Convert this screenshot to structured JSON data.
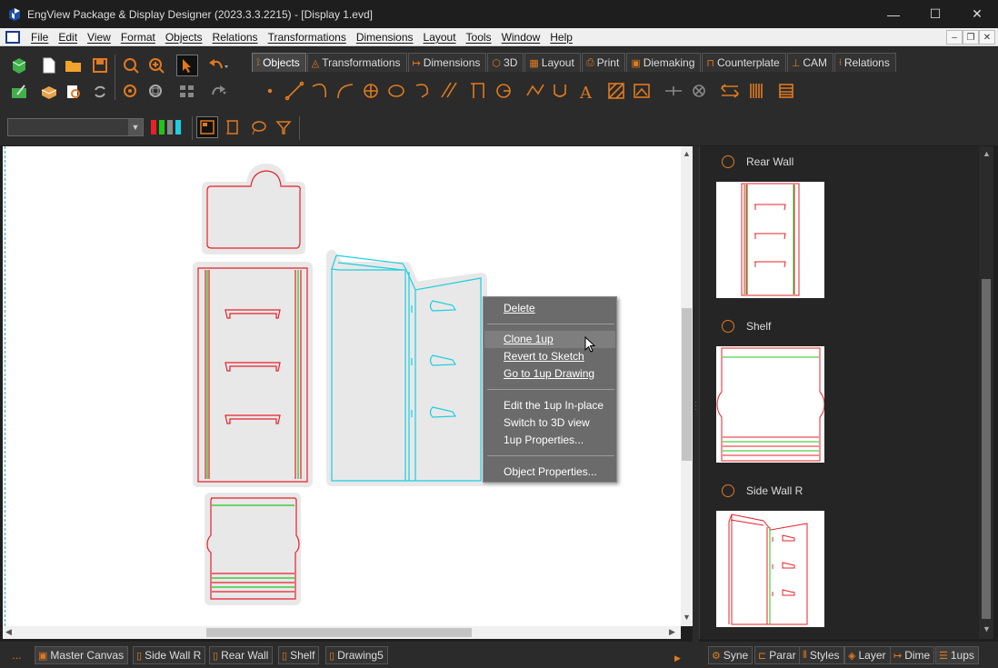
{
  "window": {
    "title": "EngView Package & Display Designer (2023.3.3.2215) - [Display 1.evd]",
    "controls": {
      "minimize": "—",
      "maximize": "☐",
      "close": "✕"
    }
  },
  "menu": [
    "File",
    "Edit",
    "View",
    "Format",
    "Objects",
    "Relations",
    "Transformations",
    "Dimensions",
    "Layout",
    "Tools",
    "Window",
    "Help"
  ],
  "mdi_controls": {
    "minimize": "–",
    "restore": "❐",
    "close": "✕"
  },
  "tabs": [
    {
      "label": "Objects",
      "icon": "objects-icon",
      "active": true
    },
    {
      "label": "Transformations",
      "icon": "transformations-icon",
      "active": false
    },
    {
      "label": "Dimensions",
      "icon": "dimensions-icon",
      "active": false
    },
    {
      "label": "3D",
      "icon": "3d-icon",
      "active": false
    },
    {
      "label": "Layout",
      "icon": "layout-icon",
      "active": false
    },
    {
      "label": "Print",
      "icon": "print-icon",
      "active": false
    },
    {
      "label": "Diemaking",
      "icon": "diemaking-icon",
      "active": false
    },
    {
      "label": "Counterplate",
      "icon": "counterplate-icon",
      "active": false
    },
    {
      "label": "CAM",
      "icon": "cam-icon",
      "active": false
    },
    {
      "label": "Relations",
      "icon": "relations-icon",
      "active": false
    }
  ],
  "combo": {
    "value": ""
  },
  "context_menu": {
    "items": [
      {
        "label": "Delete",
        "u": "D"
      },
      {
        "label": "Clone 1up",
        "u": "C",
        "hover": true
      },
      {
        "label": "Revert to Sketch",
        "u": "R"
      },
      {
        "label": "Go to 1up Drawing",
        "u": "G"
      },
      {
        "label": "Edit the 1up In-place",
        "u": ""
      },
      {
        "label": "Switch to 3D view",
        "u": ""
      },
      {
        "label": "1up Properties...",
        "u": ""
      },
      {
        "label": "Object Properties...",
        "u": "P"
      }
    ]
  },
  "ups_panel": [
    {
      "name": "Rear Wall"
    },
    {
      "name": "Shelf"
    },
    {
      "name": "Side Wall R"
    }
  ],
  "bottom_tabs": {
    "more": "...",
    "sheets": [
      "Master Canvas",
      "Side Wall R",
      "Rear Wall",
      "Shelf",
      "Drawing5"
    ],
    "panels": [
      "Syne",
      "Parar",
      "Styles",
      "Layer",
      "Dime",
      "1ups"
    ]
  },
  "colors": {
    "accent": "#e07a1f",
    "cut_line": "#e8202a",
    "crease_line": "#22c41c",
    "selected": "#1ccfe0"
  }
}
